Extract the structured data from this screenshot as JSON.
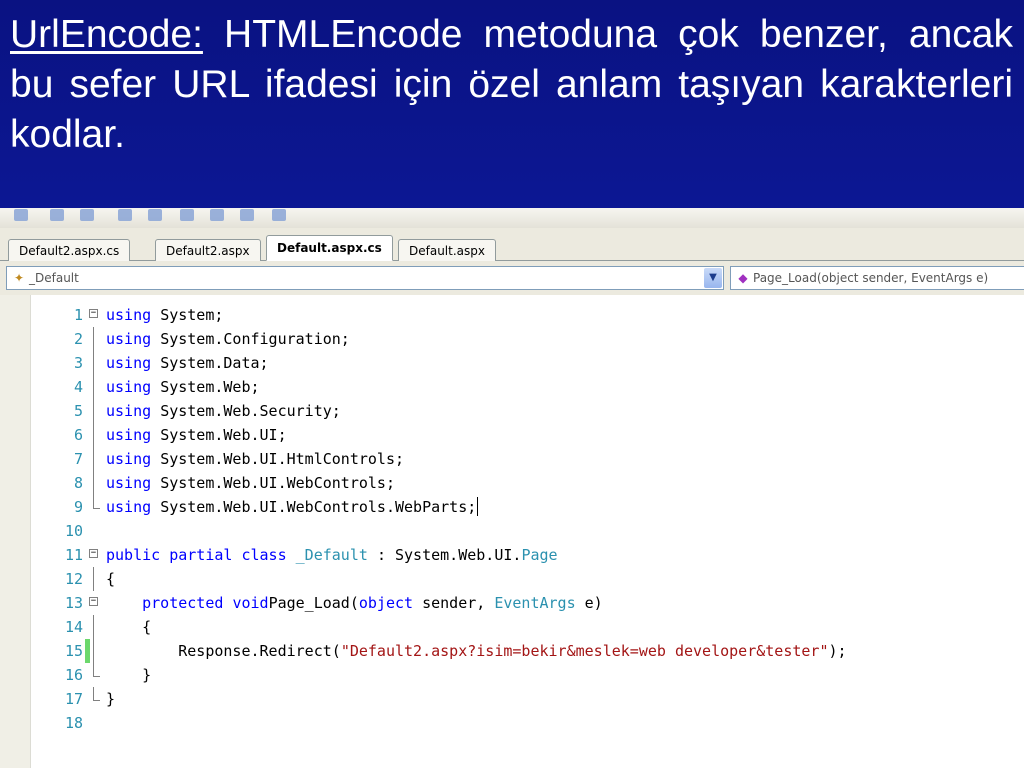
{
  "slide": {
    "term": "UrlEncode:",
    "description": "HTMLEncode metoduna çok benzer, ancak bu sefer URL ifadesi için özel anlam taşıyan karakterleri kodlar."
  },
  "tabs": [
    {
      "label": "Default2.aspx.cs",
      "active": false
    },
    {
      "label": "Default2.aspx",
      "active": false
    },
    {
      "label": "Default.aspx.cs",
      "active": true
    },
    {
      "label": "Default.aspx",
      "active": false
    }
  ],
  "navbar": {
    "class_combo": "_Default",
    "member_combo": "Page_Load(object sender, EventArgs e)"
  },
  "code_lines": [
    {
      "n": "1",
      "fold": "open",
      "tokens": [
        [
          "kw",
          "using"
        ],
        [
          "",
          "System;"
        ]
      ]
    },
    {
      "n": "2",
      "fold": "line",
      "tokens": [
        [
          "kw",
          "using"
        ],
        [
          "",
          "System.Configuration;"
        ]
      ]
    },
    {
      "n": "3",
      "fold": "line",
      "tokens": [
        [
          "kw",
          "using"
        ],
        [
          "",
          "System.Data;"
        ]
      ]
    },
    {
      "n": "4",
      "fold": "line",
      "tokens": [
        [
          "kw",
          "using"
        ],
        [
          "",
          "System.Web;"
        ]
      ]
    },
    {
      "n": "5",
      "fold": "line",
      "tokens": [
        [
          "kw",
          "using"
        ],
        [
          "",
          "System.Web.Security;"
        ]
      ]
    },
    {
      "n": "6",
      "fold": "line",
      "tokens": [
        [
          "kw",
          "using"
        ],
        [
          "",
          "System.Web.UI;"
        ]
      ]
    },
    {
      "n": "7",
      "fold": "line",
      "tokens": [
        [
          "kw",
          "using"
        ],
        [
          "",
          "System.Web.UI.HtmlControls;"
        ]
      ]
    },
    {
      "n": "8",
      "fold": "line",
      "tokens": [
        [
          "kw",
          "using"
        ],
        [
          "",
          "System.Web.UI.WebControls;"
        ]
      ]
    },
    {
      "n": "9",
      "fold": "end",
      "caret": true,
      "tokens": [
        [
          "kw",
          "using"
        ],
        [
          "",
          "System.Web.UI.WebControls.WebParts;"
        ]
      ]
    },
    {
      "n": "10",
      "fold": "none",
      "tokens": []
    },
    {
      "n": "11",
      "fold": "open",
      "tokens": [
        [
          "kw",
          "public"
        ],
        [
          "kw",
          "partial"
        ],
        [
          "kw",
          "class"
        ],
        [
          "ty",
          "_Default"
        ],
        [
          "",
          ":"
        ],
        [
          "",
          "System.Web.UI."
        ],
        [
          "ty",
          "Page",
          true
        ]
      ]
    },
    {
      "n": "12",
      "fold": "line",
      "tokens": [
        [
          "",
          "{"
        ]
      ]
    },
    {
      "n": "13",
      "fold": "open",
      "indent": "    ",
      "tokens": [
        [
          "kw",
          "protected"
        ],
        [
          "kw",
          "void"
        ],
        [
          "",
          "Page_Load(",
          true
        ],
        [
          "kw",
          "object",
          true
        ],
        [
          "",
          "sender,"
        ],
        [
          "ty",
          "EventArgs"
        ],
        [
          "",
          "e)"
        ]
      ]
    },
    {
      "n": "14",
      "fold": "line",
      "indent": "    ",
      "tokens": [
        [
          "",
          "{"
        ]
      ]
    },
    {
      "n": "15",
      "fold": "line",
      "changed": true,
      "indent": "        ",
      "tokens": [
        [
          "",
          "Response.Redirect("
        ],
        [
          "str",
          "\"Default2.aspx?isim=bekir&meslek=web developer&tester\"",
          true
        ],
        [
          "",
          ");",
          true
        ]
      ]
    },
    {
      "n": "16",
      "fold": "end",
      "indent": "    ",
      "tokens": [
        [
          "",
          "}"
        ]
      ]
    },
    {
      "n": "17",
      "fold": "end",
      "tokens": [
        [
          "",
          "}"
        ]
      ]
    },
    {
      "n": "18",
      "fold": "none",
      "tokens": []
    }
  ],
  "colors": {
    "background": "#0a1282",
    "keyword": "#0000ff",
    "type": "#2b91af",
    "string": "#a31515",
    "line_number": "#2b91af",
    "change_marker": "#6cd86c"
  }
}
